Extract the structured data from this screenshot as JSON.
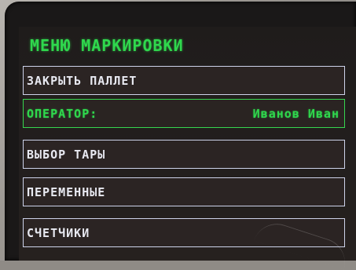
{
  "menu": {
    "title": "МЕНЮ МАРКИРОВКИ",
    "items": [
      {
        "label": "ЗАКРЫТЬ ПАЛЛЕТ",
        "value": ""
      },
      {
        "label": "ОПЕРАТОР:",
        "value": "Иванов Иван"
      },
      {
        "label": "ВЫБОР ТАРЫ",
        "value": ""
      },
      {
        "label": "ПЕРЕМЕННЫЕ",
        "value": ""
      },
      {
        "label": "СЧЕТЧИКИ",
        "value": ""
      }
    ],
    "selected_index": 1
  },
  "colors": {
    "title_text": "#2fd84d",
    "selected_border": "#36d64f",
    "item_border": "#cdd3ea",
    "item_text": "#e8e9f1",
    "screen_background": "#231f1e"
  }
}
